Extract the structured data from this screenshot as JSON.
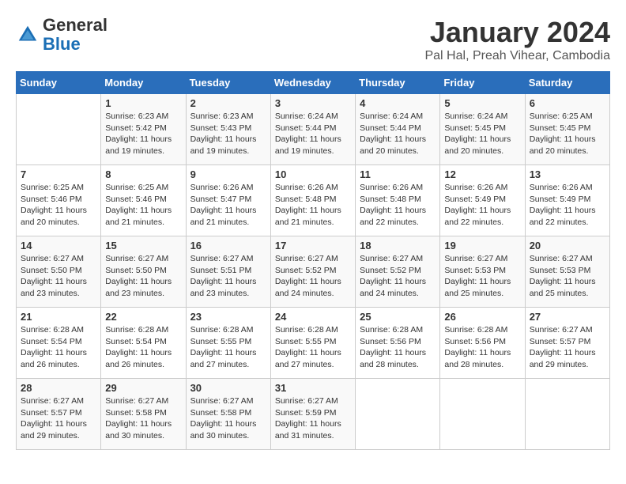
{
  "header": {
    "logo_line1": "General",
    "logo_line2": "Blue",
    "month_title": "January 2024",
    "subtitle": "Pal Hal, Preah Vihear, Cambodia"
  },
  "weekdays": [
    "Sunday",
    "Monday",
    "Tuesday",
    "Wednesday",
    "Thursday",
    "Friday",
    "Saturday"
  ],
  "weeks": [
    [
      {
        "day": "",
        "info": ""
      },
      {
        "day": "1",
        "info": "Sunrise: 6:23 AM\nSunset: 5:42 PM\nDaylight: 11 hours\nand 19 minutes."
      },
      {
        "day": "2",
        "info": "Sunrise: 6:23 AM\nSunset: 5:43 PM\nDaylight: 11 hours\nand 19 minutes."
      },
      {
        "day": "3",
        "info": "Sunrise: 6:24 AM\nSunset: 5:44 PM\nDaylight: 11 hours\nand 19 minutes."
      },
      {
        "day": "4",
        "info": "Sunrise: 6:24 AM\nSunset: 5:44 PM\nDaylight: 11 hours\nand 20 minutes."
      },
      {
        "day": "5",
        "info": "Sunrise: 6:24 AM\nSunset: 5:45 PM\nDaylight: 11 hours\nand 20 minutes."
      },
      {
        "day": "6",
        "info": "Sunrise: 6:25 AM\nSunset: 5:45 PM\nDaylight: 11 hours\nand 20 minutes."
      }
    ],
    [
      {
        "day": "7",
        "info": "Sunrise: 6:25 AM\nSunset: 5:46 PM\nDaylight: 11 hours\nand 20 minutes."
      },
      {
        "day": "8",
        "info": "Sunrise: 6:25 AM\nSunset: 5:46 PM\nDaylight: 11 hours\nand 21 minutes."
      },
      {
        "day": "9",
        "info": "Sunrise: 6:26 AM\nSunset: 5:47 PM\nDaylight: 11 hours\nand 21 minutes."
      },
      {
        "day": "10",
        "info": "Sunrise: 6:26 AM\nSunset: 5:48 PM\nDaylight: 11 hours\nand 21 minutes."
      },
      {
        "day": "11",
        "info": "Sunrise: 6:26 AM\nSunset: 5:48 PM\nDaylight: 11 hours\nand 22 minutes."
      },
      {
        "day": "12",
        "info": "Sunrise: 6:26 AM\nSunset: 5:49 PM\nDaylight: 11 hours\nand 22 minutes."
      },
      {
        "day": "13",
        "info": "Sunrise: 6:26 AM\nSunset: 5:49 PM\nDaylight: 11 hours\nand 22 minutes."
      }
    ],
    [
      {
        "day": "14",
        "info": "Sunrise: 6:27 AM\nSunset: 5:50 PM\nDaylight: 11 hours\nand 23 minutes."
      },
      {
        "day": "15",
        "info": "Sunrise: 6:27 AM\nSunset: 5:50 PM\nDaylight: 11 hours\nand 23 minutes."
      },
      {
        "day": "16",
        "info": "Sunrise: 6:27 AM\nSunset: 5:51 PM\nDaylight: 11 hours\nand 23 minutes."
      },
      {
        "day": "17",
        "info": "Sunrise: 6:27 AM\nSunset: 5:52 PM\nDaylight: 11 hours\nand 24 minutes."
      },
      {
        "day": "18",
        "info": "Sunrise: 6:27 AM\nSunset: 5:52 PM\nDaylight: 11 hours\nand 24 minutes."
      },
      {
        "day": "19",
        "info": "Sunrise: 6:27 AM\nSunset: 5:53 PM\nDaylight: 11 hours\nand 25 minutes."
      },
      {
        "day": "20",
        "info": "Sunrise: 6:27 AM\nSunset: 5:53 PM\nDaylight: 11 hours\nand 25 minutes."
      }
    ],
    [
      {
        "day": "21",
        "info": "Sunrise: 6:28 AM\nSunset: 5:54 PM\nDaylight: 11 hours\nand 26 minutes."
      },
      {
        "day": "22",
        "info": "Sunrise: 6:28 AM\nSunset: 5:54 PM\nDaylight: 11 hours\nand 26 minutes."
      },
      {
        "day": "23",
        "info": "Sunrise: 6:28 AM\nSunset: 5:55 PM\nDaylight: 11 hours\nand 27 minutes."
      },
      {
        "day": "24",
        "info": "Sunrise: 6:28 AM\nSunset: 5:55 PM\nDaylight: 11 hours\nand 27 minutes."
      },
      {
        "day": "25",
        "info": "Sunrise: 6:28 AM\nSunset: 5:56 PM\nDaylight: 11 hours\nand 28 minutes."
      },
      {
        "day": "26",
        "info": "Sunrise: 6:28 AM\nSunset: 5:56 PM\nDaylight: 11 hours\nand 28 minutes."
      },
      {
        "day": "27",
        "info": "Sunrise: 6:27 AM\nSunset: 5:57 PM\nDaylight: 11 hours\nand 29 minutes."
      }
    ],
    [
      {
        "day": "28",
        "info": "Sunrise: 6:27 AM\nSunset: 5:57 PM\nDaylight: 11 hours\nand 29 minutes."
      },
      {
        "day": "29",
        "info": "Sunrise: 6:27 AM\nSunset: 5:58 PM\nDaylight: 11 hours\nand 30 minutes."
      },
      {
        "day": "30",
        "info": "Sunrise: 6:27 AM\nSunset: 5:58 PM\nDaylight: 11 hours\nand 30 minutes."
      },
      {
        "day": "31",
        "info": "Sunrise: 6:27 AM\nSunset: 5:59 PM\nDaylight: 11 hours\nand 31 minutes."
      },
      {
        "day": "",
        "info": ""
      },
      {
        "day": "",
        "info": ""
      },
      {
        "day": "",
        "info": ""
      }
    ]
  ]
}
